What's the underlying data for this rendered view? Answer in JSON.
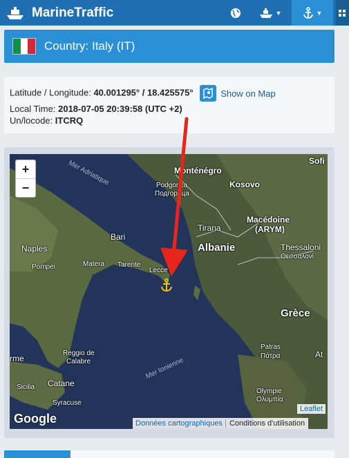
{
  "app": {
    "title": "MarineTraffic"
  },
  "nav": {
    "icons": [
      "globe-icon",
      "ship-icon",
      "anchor-icon",
      "grid-icon"
    ],
    "brand_color": "#1f6fb2",
    "active_color": "#2b8fd6"
  },
  "country": {
    "label": "Country: Italy (IT)"
  },
  "info": {
    "latlon_label": "Latitude / Longitude:",
    "latlon_value": "40.001295° / 18.425575°",
    "show_map": "Show on Map",
    "local_time_label": "Local Time:",
    "local_time_value": "2018-07-05 20:39:58 (UTC +2)",
    "unlocode_label": "Un/locode:",
    "unlocode_value": "ITCRQ"
  },
  "map": {
    "zoom_in": "+",
    "zoom_out": "−",
    "google": "Google",
    "leaflet": "Leaflet",
    "map_data": "Données cartographiques",
    "terms": "Conditions d'utilisation",
    "labels": {
      "mer_adriatique": "Mer Adriatique",
      "mer_ionienne": "Mer Ionienne",
      "sofia": "Sofi",
      "montenegro": "Monténégro",
      "podgorica": "Podgorica",
      "podgorica_cyr": "Подгорица",
      "kosovo": "Kosovo",
      "tirana": "Tirana",
      "albanie": "Albanie",
      "macedoine": "Macédoine",
      "arym": "(ARYM)",
      "thessaloniki": "Thessaloni",
      "thessaloniki_gr": "Θεσσαλονί",
      "bari": "Bari",
      "naples": "Naples",
      "pompei": "Pompei",
      "matera": "Matera",
      "tarente": "Tarente",
      "lecce": "Lecce",
      "grece": "Grèce",
      "patras": "Patras",
      "patras_gr": "Πάτρα",
      "olympia": "Olympie",
      "olympia_gr": "Ολυμπία",
      "reggio": "Reggio de",
      "calabre": "Calabre",
      "catane": "Catane",
      "sicilia": "Sicilia",
      "syracuse": "Syracuse",
      "palermo": "rme",
      "athens": "At"
    }
  }
}
